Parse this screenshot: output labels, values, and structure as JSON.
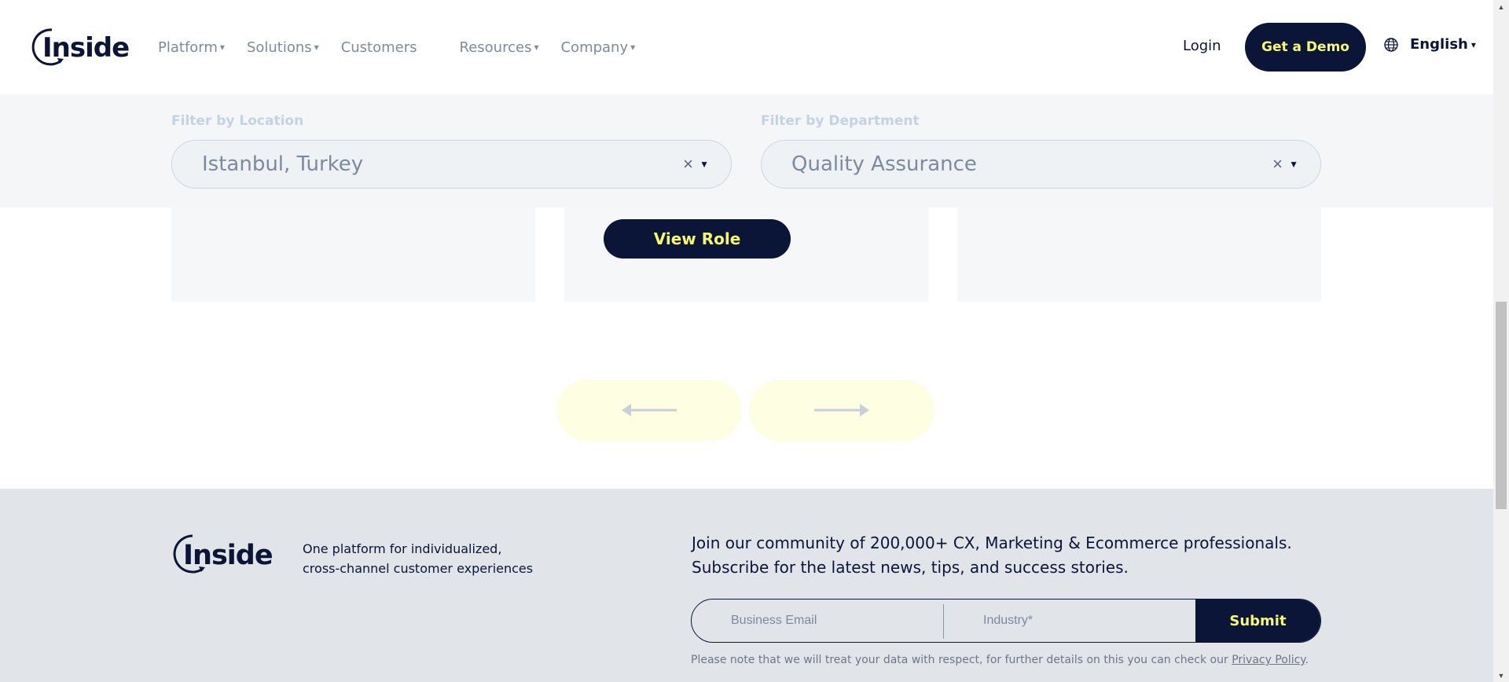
{
  "header": {
    "logo_text": "Insider",
    "nav": [
      {
        "label": "Platform",
        "has_dropdown": true
      },
      {
        "label": "Solutions",
        "has_dropdown": true
      },
      {
        "label": "Customers",
        "has_dropdown": false
      },
      {
        "label": "Resources",
        "has_dropdown": true
      },
      {
        "label": "Company",
        "has_dropdown": true
      }
    ],
    "login_label": "Login",
    "demo_label": "Get a Demo",
    "language_label": "English",
    "caret": "▾"
  },
  "filters": {
    "location": {
      "label": "Filter by Location",
      "value": "Istanbul, Turkey",
      "clear": "×",
      "arrow": "▼"
    },
    "department": {
      "label": "Filter by Department",
      "value": "Quality Assurance",
      "clear": "×",
      "arrow": "▼"
    }
  },
  "jobs": {
    "view_role_label": "View Role"
  },
  "carousel": {
    "prev_icon": "arrow-left-icon",
    "next_icon": "arrow-right-icon"
  },
  "footer": {
    "logo_text": "Insider",
    "tagline_line1": "One platform for individualized,",
    "tagline_line2": "cross-channel customer experiences",
    "community_line1": "Join our community of 200,000+ CX, Marketing & Ecommerce professionals.",
    "community_line2": "Subscribe for the latest news, tips, and success stories.",
    "email_placeholder": "Business Email",
    "industry_placeholder": "Industry*",
    "submit_label": "Submit",
    "privacy_text": "Please note that we will treat your data with respect, for further details on this you can check our ",
    "privacy_link": "Privacy Policy",
    "privacy_end": "."
  },
  "colors": {
    "navy": "#0a1537",
    "yellow": "#f7f96a",
    "muted": "#7d8a9e",
    "filter_bg": "#f4f6f8",
    "footer_bg": "#e1e4e9"
  }
}
